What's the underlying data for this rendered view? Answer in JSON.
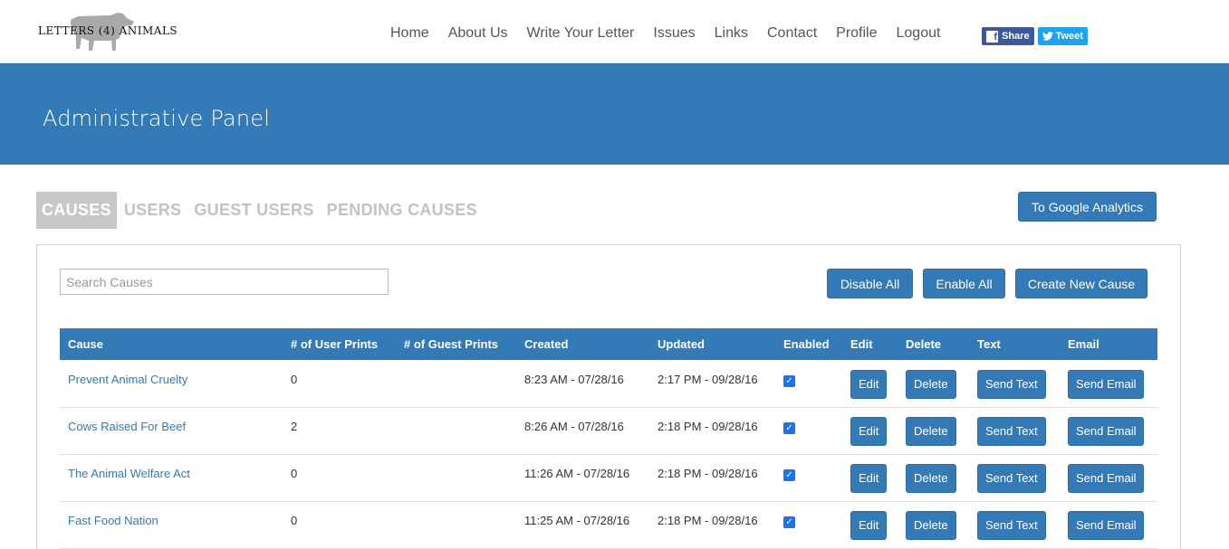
{
  "header": {
    "logo_text": "LETTERS (4) ANIMALS",
    "nav": [
      "Home",
      "About Us",
      "Write Your Letter",
      "Issues",
      "Links",
      "Contact",
      "Profile",
      "Logout"
    ],
    "share_fb": "Share",
    "share_tw": "Tweet"
  },
  "banner": {
    "title": "Administrative Panel"
  },
  "tabs": [
    "CAUSES",
    "USERS",
    "GUEST USERS",
    "PENDING CAUSES"
  ],
  "ga_button": "To Google Analytics",
  "panel": {
    "search_placeholder": "Search Causes",
    "disable_all": "Disable All",
    "enable_all": "Enable All",
    "create_new": "Create New Cause"
  },
  "table": {
    "headers": [
      "Cause",
      "# of User Prints",
      "# of Guest Prints",
      "Created",
      "Updated",
      "Enabled",
      "Edit",
      "Delete",
      "Text",
      "Email"
    ],
    "rows": [
      {
        "cause": "Prevent Animal Cruelty",
        "user_prints": "0",
        "guest_prints": "",
        "created": "8:23 AM - 07/28/16",
        "updated": "2:17 PM - 09/28/16",
        "enabled": true
      },
      {
        "cause": "Cows Raised For Beef",
        "user_prints": "2",
        "guest_prints": "",
        "created": "8:26 AM - 07/28/16",
        "updated": "2:18 PM - 09/28/16",
        "enabled": true
      },
      {
        "cause": "The Animal Welfare Act",
        "user_prints": "0",
        "guest_prints": "",
        "created": "11:26 AM - 07/28/16",
        "updated": "2:18 PM - 09/28/16",
        "enabled": true
      },
      {
        "cause": "Fast Food Nation",
        "user_prints": "0",
        "guest_prints": "",
        "created": "11:25 AM - 07/28/16",
        "updated": "2:18 PM - 09/28/16",
        "enabled": true
      }
    ],
    "edit_label": "Edit",
    "delete_label": "Delete",
    "text_label": "Send Text",
    "email_label": "Send Email"
  },
  "colors": {
    "primary": "#337ab7",
    "tab_active_bg": "#c8c8c8",
    "tab_inactive": "#c2c2c2",
    "facebook": "#3b5998",
    "twitter": "#1da1f2"
  },
  "icons": {
    "facebook": "facebook-icon",
    "twitter": "twitter-icon",
    "checkbox": "checkmark-icon",
    "logo": "cow-logo-icon"
  }
}
